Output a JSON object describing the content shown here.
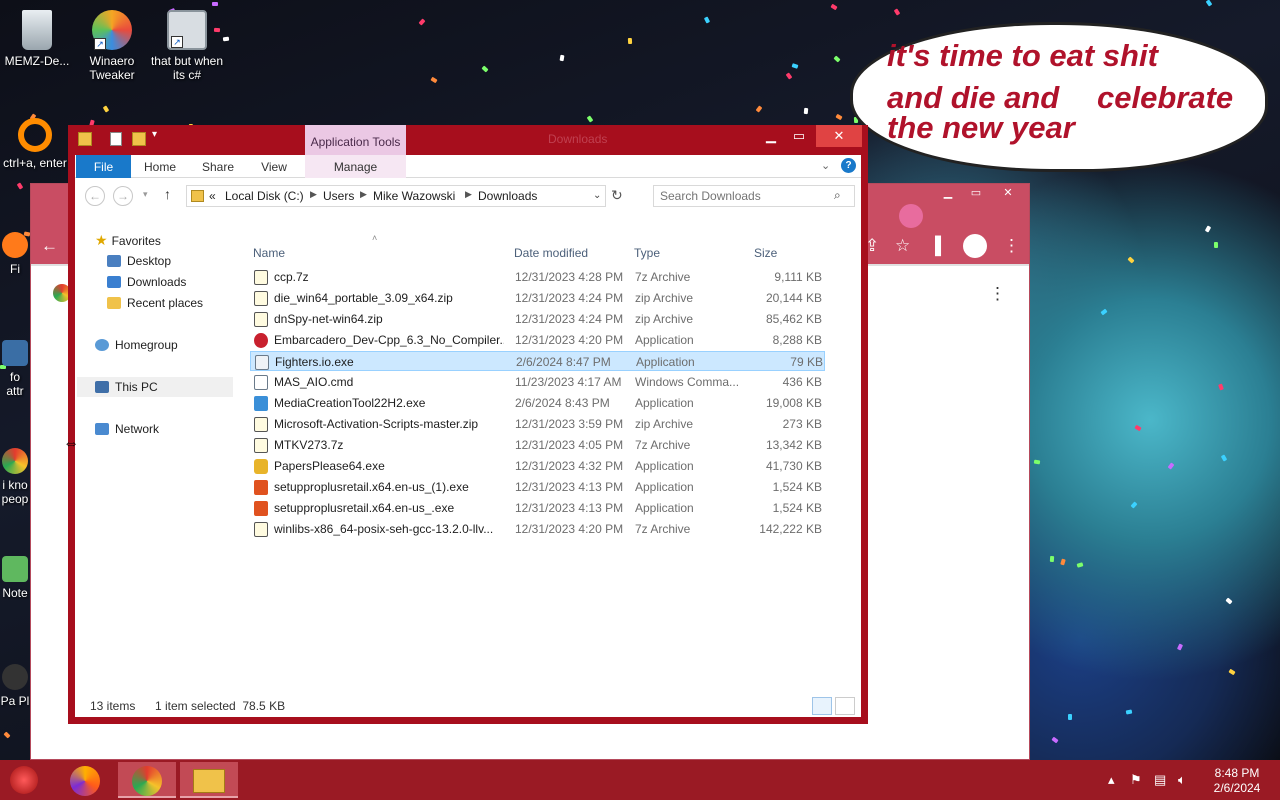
{
  "desktop": {
    "icons": [
      {
        "name": "recycle-bin",
        "label": "MEMZ-De..."
      },
      {
        "name": "winaero-tweaker",
        "label": "Winaero Tweaker"
      },
      {
        "name": "that-but",
        "label": "that but when its c#"
      },
      {
        "name": "ctrl-a",
        "label": "ctrl+a, enter"
      },
      {
        "name": "fi",
        "label": "Fi"
      },
      {
        "name": "fo-attr",
        "label": "fo attr"
      },
      {
        "name": "i-kno-peop",
        "label": "i kno peop"
      },
      {
        "name": "note",
        "label": "Note"
      },
      {
        "name": "pa-pl",
        "label": "Pa Pl"
      }
    ],
    "bubble_lines": [
      "it's time to eat shit",
      "and die and",
      "celebrate",
      "the new year"
    ]
  },
  "explorer": {
    "title": "Downloads",
    "app_tools_label": "Application Tools",
    "ribbon_tabs": [
      "File",
      "Home",
      "Share",
      "View",
      "Manage"
    ],
    "breadcrumb": [
      "«",
      "Local Disk (C:)",
      "Users",
      "Mike Wazowski",
      "Downloads"
    ],
    "search_placeholder": "Search Downloads",
    "nav": {
      "favorites": "Favorites",
      "desktop": "Desktop",
      "downloads": "Downloads",
      "recent": "Recent places",
      "homegroup": "Homegroup",
      "thispc": "This PC",
      "network": "Network"
    },
    "columns": {
      "name": "Name",
      "date": "Date modified",
      "type": "Type",
      "size": "Size"
    },
    "files": [
      {
        "name": "ccp.7z",
        "date": "12/31/2023 4:28 PM",
        "type": "7z Archive",
        "size": "9,111 KB",
        "icon": "archive"
      },
      {
        "name": "die_win64_portable_3.09_x64.zip",
        "date": "12/31/2023 4:24 PM",
        "type": "zip Archive",
        "size": "20,144 KB",
        "icon": "archive"
      },
      {
        "name": "dnSpy-net-win64.zip",
        "date": "12/31/2023 4:24 PM",
        "type": "zip Archive",
        "size": "85,462 KB",
        "icon": "archive"
      },
      {
        "name": "Embarcadero_Dev-Cpp_6.3_No_Compiler...",
        "date": "12/31/2023 4:20 PM",
        "type": "Application",
        "size": "8,288 KB",
        "icon": "devcpp"
      },
      {
        "name": "Fighters.io.exe",
        "date": "2/6/2024 8:47 PM",
        "type": "Application",
        "size": "79 KB",
        "icon": "exe"
      },
      {
        "name": "MAS_AIO.cmd",
        "date": "11/23/2023 4:17 AM",
        "type": "Windows Comma...",
        "size": "436 KB",
        "icon": "cmd"
      },
      {
        "name": "MediaCreationTool22H2.exe",
        "date": "2/6/2024 8:43 PM",
        "type": "Application",
        "size": "19,008 KB",
        "icon": "media"
      },
      {
        "name": "Microsoft-Activation-Scripts-master.zip",
        "date": "12/31/2023 3:59 PM",
        "type": "zip Archive",
        "size": "273 KB",
        "icon": "archive"
      },
      {
        "name": "MTKV273.7z",
        "date": "12/31/2023 4:05 PM",
        "type": "7z Archive",
        "size": "13,342 KB",
        "icon": "archive"
      },
      {
        "name": "PapersPlease64.exe",
        "date": "12/31/2023 4:32 PM",
        "type": "Application",
        "size": "41,730 KB",
        "icon": "papers"
      },
      {
        "name": "setupproplusretail.x64.en-us_(1).exe",
        "date": "12/31/2023 4:13 PM",
        "type": "Application",
        "size": "1,524 KB",
        "icon": "office"
      },
      {
        "name": "setupproplusretail.x64.en-us_.exe",
        "date": "12/31/2023 4:13 PM",
        "type": "Application",
        "size": "1,524 KB",
        "icon": "office"
      },
      {
        "name": "winlibs-x86_64-posix-seh-gcc-13.2.0-llv...",
        "date": "12/31/2023 4:20 PM",
        "type": "7z Archive",
        "size": "142,222 KB",
        "icon": "archive"
      }
    ],
    "selected_index": 4,
    "status": {
      "count": "13 items",
      "selection": "1 item selected  78.5 KB"
    }
  },
  "taskbar": {
    "clock_time": "8:48 PM",
    "clock_date": "2/6/2024"
  },
  "colors": {
    "explorer_frame": "#a70e1d",
    "taskbar": "#9a1a24",
    "selection": "#cce8ff",
    "file_tab": "#1979ca"
  }
}
